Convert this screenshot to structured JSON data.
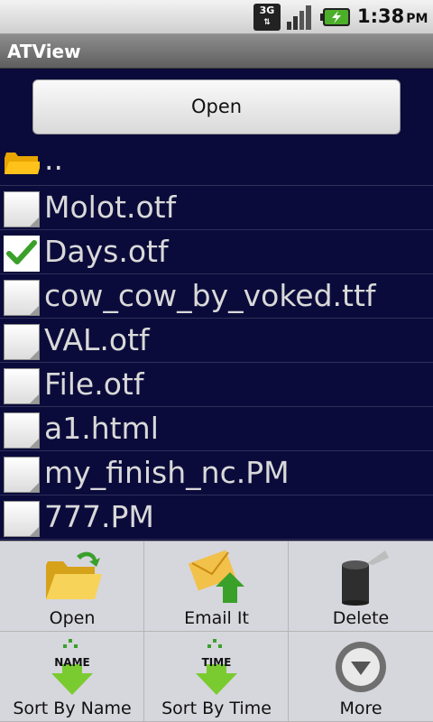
{
  "statusbar": {
    "network": "3G",
    "time": "1:38",
    "ampm": "PM",
    "icons": [
      "3g-icon",
      "signal-icon",
      "battery-charging-icon"
    ]
  },
  "app": {
    "title": "ATView"
  },
  "open_button": {
    "label": "Open"
  },
  "files": [
    {
      "name": "..",
      "type": "folder",
      "checked": false
    },
    {
      "name": "Molot.otf",
      "type": "file",
      "checked": false
    },
    {
      "name": "Days.otf",
      "type": "file",
      "checked": true
    },
    {
      "name": "cow_cow_by_voked.ttf",
      "type": "file",
      "checked": false
    },
    {
      "name": "VAL.otf",
      "type": "file",
      "checked": false
    },
    {
      "name": "File.otf",
      "type": "file",
      "checked": false
    },
    {
      "name": "a1.html",
      "type": "file",
      "checked": false
    },
    {
      "name": "my_finish_nc.PM",
      "type": "file",
      "checked": false
    },
    {
      "name": "777.PM",
      "type": "file",
      "checked": false
    }
  ],
  "menu": {
    "items": [
      {
        "label": "Open",
        "icon": "folder-open-icon"
      },
      {
        "label": "Email It",
        "icon": "email-icon"
      },
      {
        "label": "Delete",
        "icon": "trash-can-icon"
      },
      {
        "label": "Sort By Name",
        "icon": "sort-by-name-icon",
        "badge": "NAME"
      },
      {
        "label": "Sort By Time",
        "icon": "sort-by-time-icon",
        "badge": "TIME"
      },
      {
        "label": "More",
        "icon": "more-icon"
      }
    ]
  },
  "colors": {
    "list_bg": "#0b0b3b",
    "text": "#d9d9d9",
    "check": "#3aa02a"
  }
}
